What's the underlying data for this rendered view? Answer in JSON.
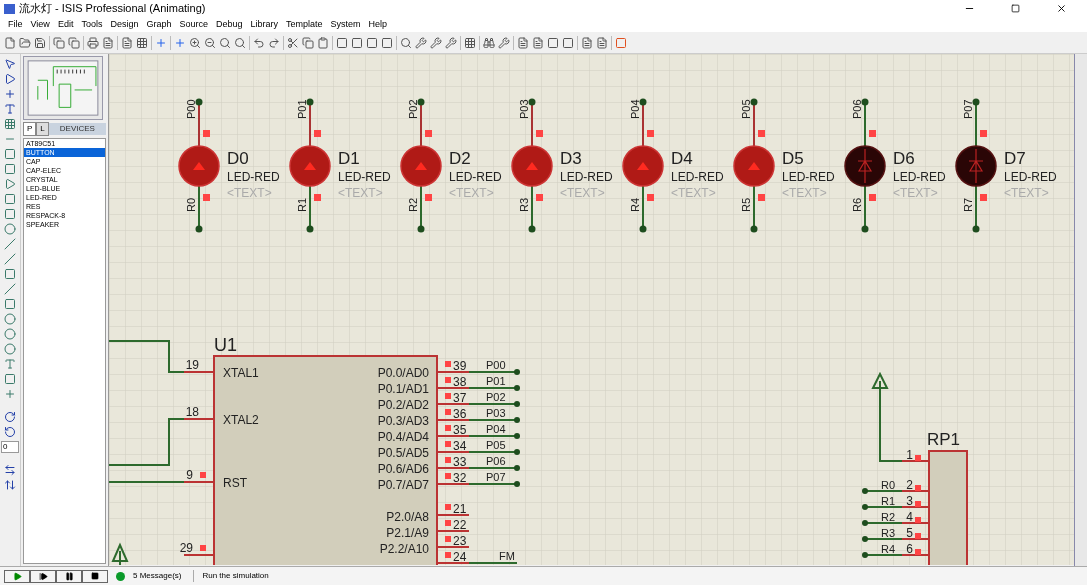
{
  "window": {
    "title": "流水灯 - ISIS Professional (Animating)"
  },
  "menu": [
    "File",
    "View",
    "Edit",
    "Tools",
    "Design",
    "Graph",
    "Source",
    "Debug",
    "Library",
    "Template",
    "System",
    "Help"
  ],
  "devices": {
    "tabs": [
      {
        "label": "P",
        "selected": true
      },
      {
        "label": "L",
        "selected": false
      }
    ],
    "header": "DEVICES",
    "items": [
      {
        "label": "AT89C51",
        "selected": false
      },
      {
        "label": "BUTTON",
        "selected": true
      },
      {
        "label": "CAP",
        "selected": false
      },
      {
        "label": "CAP-ELEC",
        "selected": false
      },
      {
        "label": "CRYSTAL",
        "selected": false
      },
      {
        "label": "LED-BLUE",
        "selected": false
      },
      {
        "label": "LED-RED",
        "selected": false
      },
      {
        "label": "RES",
        "selected": false
      },
      {
        "label": "RESPACK-8",
        "selected": false
      },
      {
        "label": "SPEAKER",
        "selected": false
      }
    ]
  },
  "rotation_field": {
    "value": "0"
  },
  "schematic": {
    "leds": [
      {
        "ref": "D0",
        "value": "LED-RED",
        "text": "<TEXT>",
        "top_net": "P00",
        "bottom_net": "R0",
        "lit": true
      },
      {
        "ref": "D1",
        "value": "LED-RED",
        "text": "<TEXT>",
        "top_net": "P01",
        "bottom_net": "R1",
        "lit": true
      },
      {
        "ref": "D2",
        "value": "LED-RED",
        "text": "<TEXT>",
        "top_net": "P02",
        "bottom_net": "R2",
        "lit": true
      },
      {
        "ref": "D3",
        "value": "LED-RED",
        "text": "<TEXT>",
        "top_net": "P03",
        "bottom_net": "R3",
        "lit": true
      },
      {
        "ref": "D4",
        "value": "LED-RED",
        "text": "<TEXT>",
        "top_net": "P04",
        "bottom_net": "R4",
        "lit": true
      },
      {
        "ref": "D5",
        "value": "LED-RED",
        "text": "<TEXT>",
        "top_net": "P05",
        "bottom_net": "R5",
        "lit": true
      },
      {
        "ref": "D6",
        "value": "LED-RED",
        "text": "<TEXT>",
        "top_net": "P06",
        "bottom_net": "R6",
        "lit": false
      },
      {
        "ref": "D7",
        "value": "LED-RED",
        "text": "<TEXT>",
        "top_net": "P07",
        "bottom_net": "R7",
        "lit": false
      }
    ],
    "u1": {
      "ref": "U1",
      "left_pins": [
        {
          "number": "19",
          "name": "XTAL1"
        },
        {
          "number": "18",
          "name": "XTAL2"
        },
        {
          "number": "9",
          "name": "RST"
        },
        {
          "number": "29"
        }
      ],
      "port0_pins": [
        {
          "number": "39",
          "name": "P0.0/AD0",
          "net": "P00"
        },
        {
          "number": "38",
          "name": "P0.1/AD1",
          "net": "P01"
        },
        {
          "number": "37",
          "name": "P0.2/AD2",
          "net": "P02"
        },
        {
          "number": "36",
          "name": "P0.3/AD3",
          "net": "P03"
        },
        {
          "number": "35",
          "name": "P0.4/AD4",
          "net": "P04"
        },
        {
          "number": "34",
          "name": "P0.5/AD5",
          "net": "P05"
        },
        {
          "number": "33",
          "name": "P0.6/AD6",
          "net": "P06"
        },
        {
          "number": "32",
          "name": "P0.7/AD7",
          "net": "P07"
        }
      ],
      "port2_pins": [
        {
          "number": "21",
          "name": "P2.0/A8"
        },
        {
          "number": "22",
          "name": "P2.1/A9"
        },
        {
          "number": "23",
          "name": "P2.2/A10"
        },
        {
          "number": "24",
          "net": "FM"
        }
      ]
    },
    "rp1": {
      "ref": "RP1",
      "pins": [
        {
          "number": "1"
        },
        {
          "number": "2",
          "net": "R0"
        },
        {
          "number": "3",
          "net": "R1"
        },
        {
          "number": "4",
          "net": "R2"
        },
        {
          "number": "5",
          "net": "R3"
        },
        {
          "number": "6",
          "net": "R4"
        }
      ]
    }
  },
  "status_bar": {
    "messages": "5 Message(s)",
    "hint": "Run the simulation"
  }
}
